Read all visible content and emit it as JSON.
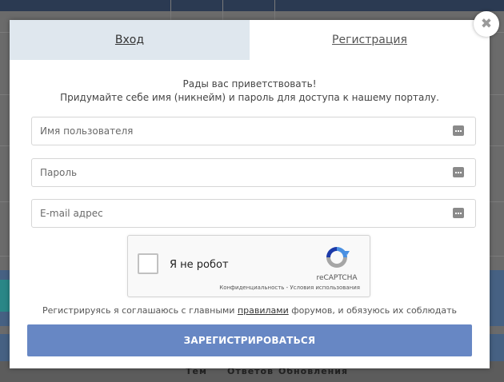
{
  "background": {
    "footer_columns": [
      "Тем",
      "Ответов",
      "Обновления"
    ]
  },
  "modal": {
    "close_symbol": "✖",
    "tabs": [
      {
        "label": "Вход",
        "active": false
      },
      {
        "label": "Регистрация",
        "active": true
      }
    ],
    "greeting_line1": "Рады вас приветствовать!",
    "greeting_line2": "Придумайте себе имя (никнейм) и пароль для доступа к нашему порталу.",
    "fields": {
      "username": {
        "placeholder": "Имя пользователя",
        "value": ""
      },
      "password": {
        "placeholder": "Пароль",
        "value": ""
      },
      "email": {
        "placeholder": "E-mail адрес",
        "value": ""
      }
    },
    "captcha": {
      "label": "Я не робот",
      "brand": "reCAPTCHA",
      "links": "Конфиденциальность - Условия использования"
    },
    "terms": {
      "before": "Регистрируясь я соглашаюсь с главными ",
      "link": "правилами",
      "after": " форумов, и обязуюсь их соблюдать"
    },
    "submit_label": "ЗАРЕГИСТРИРОВАТЬСЯ"
  },
  "colors": {
    "accent_button": "#6787c4",
    "inactive_tab": "#dfe7ee",
    "overlay": "#6b6b6b"
  }
}
